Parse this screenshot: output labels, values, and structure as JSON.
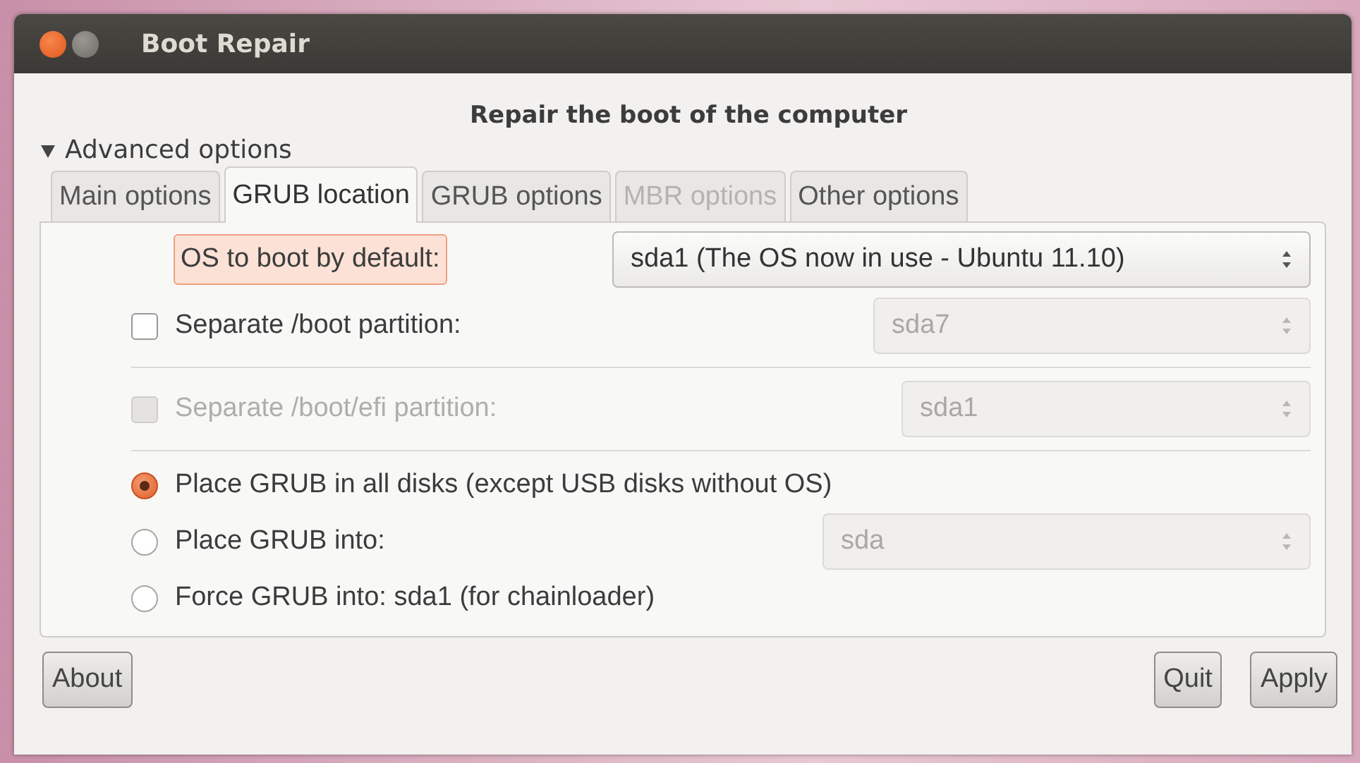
{
  "window": {
    "title": "Boot Repair"
  },
  "heading": "Repair the boot of the computer",
  "advanced": {
    "label": "Advanced options",
    "expanded": true
  },
  "tabs": [
    {
      "label": "Main options",
      "selected": false,
      "disabled": false
    },
    {
      "label": "GRUB location",
      "selected": true,
      "disabled": false
    },
    {
      "label": "GRUB options",
      "selected": false,
      "disabled": false
    },
    {
      "label": "MBR options",
      "selected": false,
      "disabled": true
    },
    {
      "label": "Other options",
      "selected": false,
      "disabled": false
    }
  ],
  "rows": [
    {
      "kind": "label-combo",
      "label": "OS to boot by default:",
      "highlighted": true,
      "combo": {
        "value": "sda1 (The OS now in use - Ubuntu 11.10)",
        "disabled": false
      }
    },
    {
      "kind": "check",
      "label": "Separate /boot partition:",
      "checked": false,
      "disabled": false,
      "combo": {
        "value": "sda7",
        "disabled": true
      }
    },
    {
      "kind": "separator"
    },
    {
      "kind": "check",
      "label": "Separate /boot/efi partition:",
      "checked": false,
      "disabled": true,
      "combo": {
        "value": "sda1",
        "disabled": true
      }
    },
    {
      "kind": "separator"
    },
    {
      "kind": "radio",
      "label": "Place GRUB in all disks (except USB disks without OS)",
      "selected": true
    },
    {
      "kind": "radio",
      "label": "Place GRUB into:",
      "selected": false,
      "combo": {
        "value": "sda",
        "disabled": true
      }
    },
    {
      "kind": "radio",
      "label": "Force GRUB into: sda1 (for chainloader)",
      "selected": false
    }
  ],
  "buttons_left": [
    "About"
  ],
  "buttons_right": [
    "Quit",
    "Apply"
  ]
}
